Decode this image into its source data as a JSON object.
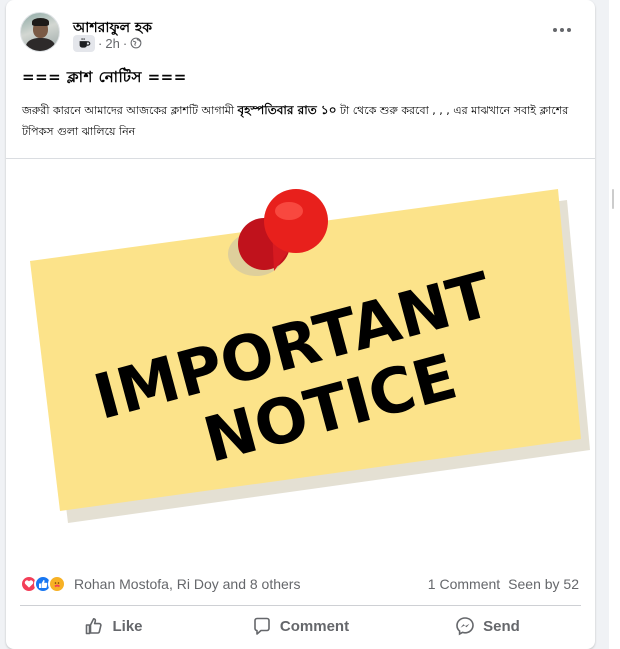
{
  "post": {
    "author": "আশরাফুল হক",
    "time": "2h",
    "separator": "·",
    "title": "=== ক্লাশ নোটিস ===",
    "body_part1": "জরুরী কারনে আমাদের আজকের ক্লাশটি আগামী ",
    "body_bold": "বৃহস্পতিবার রাত ১০",
    "body_part2": " টা থেকে শুরু করবো , , , এর মাঝখানে সবাই ক্লাশের টপিকস গুলা ঝালিয়ে নিন",
    "image_text": [
      "IMPORTANT",
      "NOTICE"
    ]
  },
  "stats": {
    "reactors": "Rohan Mostofa, Ri Doy and 8 others",
    "comments": "1 Comment",
    "seen": "Seen by 52"
  },
  "actions": {
    "like": "Like",
    "comment": "Comment",
    "send": "Send"
  },
  "colors": {
    "like_blue": "#1877f2",
    "love_red": "#f33e58",
    "care_yellow": "#f7b125",
    "note_yellow": "#fce38a",
    "pin_red": "#e8201c"
  },
  "icons": [
    "coffee-icon",
    "globe-icon",
    "more-options-icon",
    "love-reaction-icon",
    "like-reaction-icon",
    "care-reaction-icon",
    "like-icon",
    "comment-icon",
    "messenger-icon"
  ]
}
